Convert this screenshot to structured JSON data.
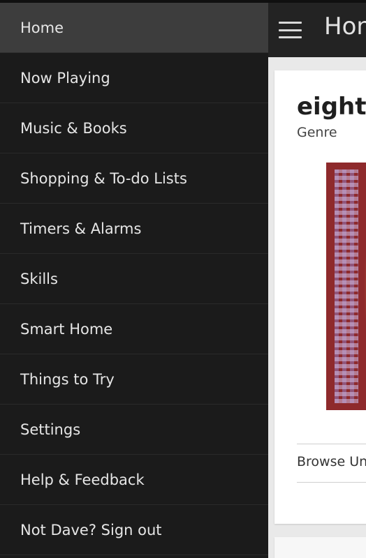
{
  "drawer": {
    "items": [
      {
        "label": "Home",
        "active": true
      },
      {
        "label": "Now Playing"
      },
      {
        "label": "Music & Books"
      },
      {
        "label": "Shopping & To-do Lists"
      },
      {
        "label": "Timers & Alarms"
      },
      {
        "label": "Skills"
      },
      {
        "label": "Smart Home"
      },
      {
        "label": "Things to Try"
      },
      {
        "label": "Settings"
      },
      {
        "label": "Help & Feedback"
      },
      {
        "label": "Not Dave? Sign out"
      }
    ]
  },
  "appbar": {
    "title": "Hon",
    "menu_icon": "hamburger-menu-icon"
  },
  "card": {
    "title": "eightie",
    "subtitle": "Genre",
    "link": "Browse Un"
  },
  "colors": {
    "drawer_bg": "#1b1b1b",
    "drawer_active": "#3d3d3d",
    "appbar_bg": "#232323",
    "content_bg": "#e9e9e9",
    "album_red": "#8e2a2c"
  }
}
